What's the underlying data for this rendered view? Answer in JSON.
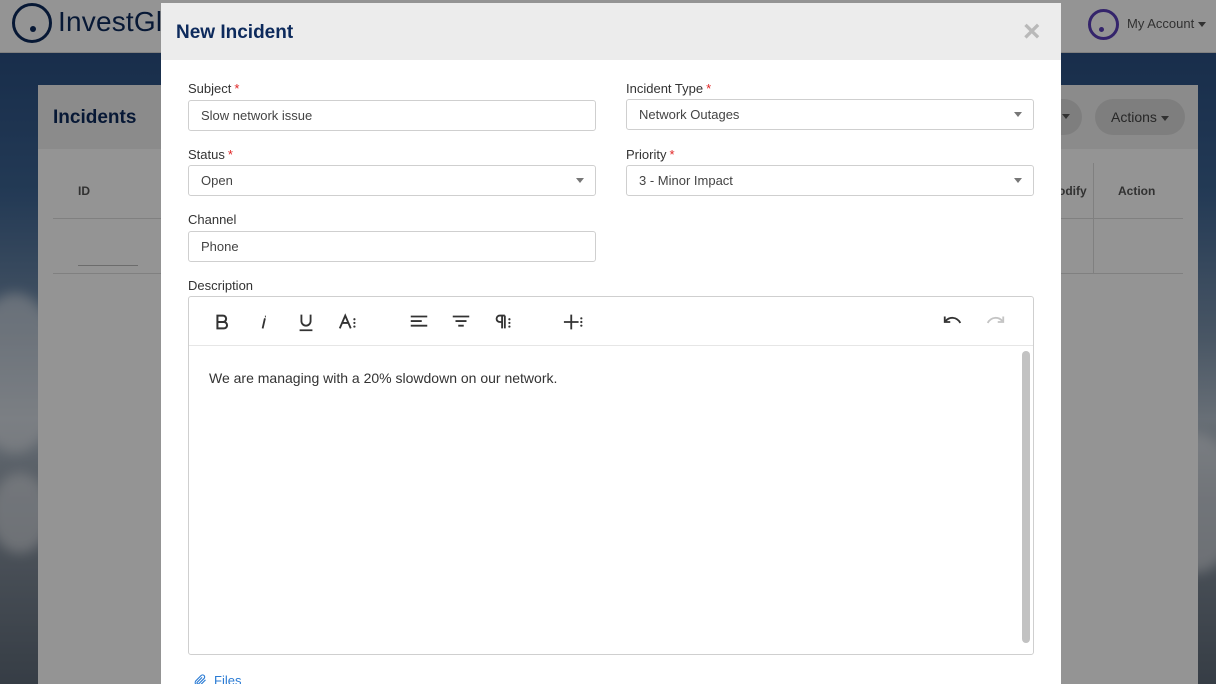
{
  "app": {
    "logo_text": "InvestGla",
    "account_label": "My Account"
  },
  "background": {
    "page_title": "Incidents",
    "actions_button": "Actions",
    "columns": {
      "id": "ID",
      "modify": "odify",
      "action": "Action"
    }
  },
  "modal": {
    "title": "New Incident",
    "close_glyph": "×",
    "required_marker": "*",
    "fields": {
      "subject": {
        "label": "Subject",
        "value": "Slow network issue"
      },
      "incident_type": {
        "label": "Incident Type",
        "value": "Network Outages"
      },
      "status": {
        "label": "Status",
        "value": "Open"
      },
      "priority": {
        "label": "Priority",
        "value": "3 - Minor Impact"
      },
      "channel": {
        "label": "Channel",
        "value": "Phone"
      },
      "description": {
        "label": "Description",
        "value": "We are managing with a 20% slowdown on our network."
      }
    },
    "files_label": "Files",
    "toolbar_icons": [
      "bold-icon",
      "italic-icon",
      "underline-icon",
      "text-size-icon",
      "align-left-icon",
      "align-center-icon",
      "paragraph-format-icon",
      "insert-more-icon",
      "undo-icon",
      "redo-icon"
    ]
  },
  "colors": {
    "brand_navy": "#0d2a5c",
    "required_red": "#e02424",
    "link_blue": "#2a7bd4",
    "account_purple": "#5b3fb8"
  }
}
